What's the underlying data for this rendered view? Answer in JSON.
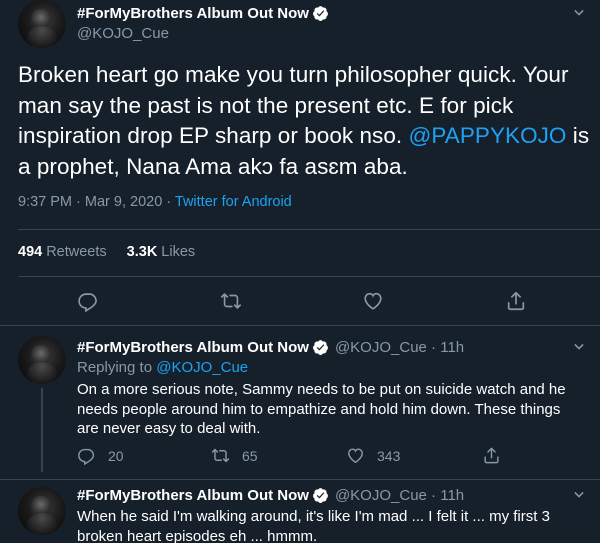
{
  "main_tweet": {
    "display_name": "#ForMyBrothers Album Out Now",
    "handle": "@KOJO_Cue",
    "text_before_mention": "Broken heart go make you turn philosopher quick. Your man say the past is not the present etc. E for pick inspiration drop EP sharp or book nso. ",
    "mention": "@PAPPYKOJO",
    "text_after_mention": " is a prophet, Nana Ama akɔ fa asɛm aba.",
    "timestamp": "9:37 PM · Mar 9, 2020 · ",
    "source": "Twitter for Android",
    "retweets_count": "494",
    "retweets_label": "Retweets",
    "likes_count": "3.3K",
    "likes_label": "Likes",
    "icons": [
      "reply-icon",
      "retweet-icon",
      "like-icon",
      "share-icon"
    ]
  },
  "replies": [
    {
      "display_name": "#ForMyBrothers Album Out Now",
      "handle_time": "@KOJO_Cue · 11h",
      "replying_label": "Replying to ",
      "replying_to": "@KOJO_Cue",
      "text": "On a more serious note, Sammy needs to be put on suicide watch and he needs people around him to empathize and hold him down. These things are never easy to deal with.",
      "reply_count": "20",
      "retweet_count": "65",
      "like_count": "343"
    },
    {
      "display_name": "#ForMyBrothers Album Out Now",
      "handle_time": "@KOJO_Cue · 11h",
      "text": "When he said I'm walking around, it's like I'm mad ... I felt it ... my first 3 broken heart episodes eh ... hmmm."
    }
  ],
  "colors": {
    "background": "#15202b",
    "accent": "#1da1f2",
    "secondary_text": "#8899a6",
    "divider": "#38444d"
  }
}
